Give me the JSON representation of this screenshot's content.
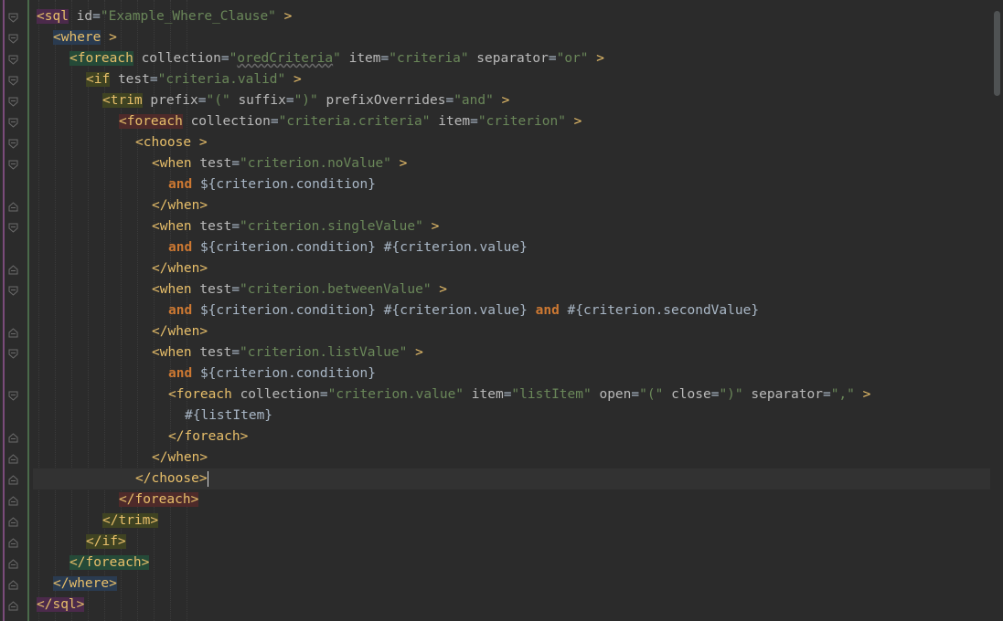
{
  "editor": {
    "lines": [
      {
        "fold": "open",
        "segments": [
          {
            "c": "tag",
            "t": "<sql",
            "h": "magenta"
          },
          {
            "c": "ws",
            "t": " "
          },
          {
            "c": "attr",
            "t": "id"
          },
          {
            "c": "text",
            "t": "="
          },
          {
            "c": "val",
            "t": "\"Example_Where_Clause\""
          },
          {
            "c": "ws",
            "t": " "
          },
          {
            "c": "tag",
            "t": ">"
          }
        ]
      },
      {
        "fold": "open",
        "segments": [
          {
            "c": "tag",
            "t": "<where",
            "h": "blue"
          },
          {
            "c": "ws",
            "t": " "
          },
          {
            "c": "tag",
            "t": ">"
          }
        ]
      },
      {
        "fold": "open",
        "segments": [
          {
            "c": "tag",
            "t": "<foreach",
            "h": "green"
          },
          {
            "c": "ws",
            "t": " "
          },
          {
            "c": "attr",
            "t": "collection"
          },
          {
            "c": "text",
            "t": "="
          },
          {
            "c": "val",
            "t": "\""
          },
          {
            "c": "val",
            "t": "oredCriteria",
            "sq": true
          },
          {
            "c": "val",
            "t": "\""
          },
          {
            "c": "ws",
            "t": " "
          },
          {
            "c": "attr",
            "t": "item"
          },
          {
            "c": "text",
            "t": "="
          },
          {
            "c": "val",
            "t": "\"criteria\""
          },
          {
            "c": "ws",
            "t": " "
          },
          {
            "c": "attr",
            "t": "separator"
          },
          {
            "c": "text",
            "t": "="
          },
          {
            "c": "val",
            "t": "\"or\""
          },
          {
            "c": "ws",
            "t": " "
          },
          {
            "c": "tag",
            "t": ">"
          }
        ]
      },
      {
        "fold": "open",
        "segments": [
          {
            "c": "tag",
            "t": "<if",
            "h": "olive"
          },
          {
            "c": "ws",
            "t": " "
          },
          {
            "c": "attr",
            "t": "test"
          },
          {
            "c": "text",
            "t": "="
          },
          {
            "c": "val",
            "t": "\"criteria.valid\""
          },
          {
            "c": "ws",
            "t": " "
          },
          {
            "c": "tag",
            "t": ">"
          }
        ]
      },
      {
        "fold": "open",
        "segments": [
          {
            "c": "tag",
            "t": "<trim",
            "h": "olive"
          },
          {
            "c": "ws",
            "t": " "
          },
          {
            "c": "attr",
            "t": "prefix"
          },
          {
            "c": "text",
            "t": "="
          },
          {
            "c": "val",
            "t": "\"(\""
          },
          {
            "c": "ws",
            "t": " "
          },
          {
            "c": "attr",
            "t": "suffix"
          },
          {
            "c": "text",
            "t": "="
          },
          {
            "c": "val",
            "t": "\")\""
          },
          {
            "c": "ws",
            "t": " "
          },
          {
            "c": "attr",
            "t": "prefixOverrides"
          },
          {
            "c": "text",
            "t": "="
          },
          {
            "c": "val",
            "t": "\"and\""
          },
          {
            "c": "ws",
            "t": " "
          },
          {
            "c": "tag",
            "t": ">"
          }
        ]
      },
      {
        "fold": "open",
        "segments": [
          {
            "c": "tag",
            "t": "<foreach",
            "h": "red"
          },
          {
            "c": "ws",
            "t": " "
          },
          {
            "c": "attr",
            "t": "collection"
          },
          {
            "c": "text",
            "t": "="
          },
          {
            "c": "val",
            "t": "\"criteria.criteria\""
          },
          {
            "c": "ws",
            "t": " "
          },
          {
            "c": "attr",
            "t": "item"
          },
          {
            "c": "text",
            "t": "="
          },
          {
            "c": "val",
            "t": "\"criterion\""
          },
          {
            "c": "ws",
            "t": " "
          },
          {
            "c": "tag",
            "t": ">"
          }
        ]
      },
      {
        "fold": "open",
        "segments": [
          {
            "c": "tag",
            "t": "<choose"
          },
          {
            "c": "ws",
            "t": " "
          },
          {
            "c": "tag",
            "t": ">"
          }
        ]
      },
      {
        "fold": "open",
        "segments": [
          {
            "c": "tag",
            "t": "<when"
          },
          {
            "c": "ws",
            "t": " "
          },
          {
            "c": "attr",
            "t": "test"
          },
          {
            "c": "text",
            "t": "="
          },
          {
            "c": "val",
            "t": "\"criterion.noValue\""
          },
          {
            "c": "ws",
            "t": " "
          },
          {
            "c": "tag",
            "t": ">"
          }
        ]
      },
      {
        "fold": "none",
        "segments": [
          {
            "c": "kw",
            "t": "and"
          },
          {
            "c": "ws",
            "t": " "
          },
          {
            "c": "text",
            "t": "${criterion.condition}"
          }
        ]
      },
      {
        "fold": "close",
        "segments": [
          {
            "c": "tag",
            "t": "</when>"
          }
        ]
      },
      {
        "fold": "open",
        "segments": [
          {
            "c": "tag",
            "t": "<when"
          },
          {
            "c": "ws",
            "t": " "
          },
          {
            "c": "attr",
            "t": "test"
          },
          {
            "c": "text",
            "t": "="
          },
          {
            "c": "val",
            "t": "\"criterion.singleValue\""
          },
          {
            "c": "ws",
            "t": " "
          },
          {
            "c": "tag",
            "t": ">"
          }
        ]
      },
      {
        "fold": "none",
        "segments": [
          {
            "c": "kw",
            "t": "and"
          },
          {
            "c": "ws",
            "t": " "
          },
          {
            "c": "text",
            "t": "${criterion.condition}"
          },
          {
            "c": "ws",
            "t": " "
          },
          {
            "c": "text",
            "t": "#{criterion.value}"
          }
        ]
      },
      {
        "fold": "close",
        "segments": [
          {
            "c": "tag",
            "t": "</when>"
          }
        ]
      },
      {
        "fold": "open",
        "segments": [
          {
            "c": "tag",
            "t": "<when"
          },
          {
            "c": "ws",
            "t": " "
          },
          {
            "c": "attr",
            "t": "test"
          },
          {
            "c": "text",
            "t": "="
          },
          {
            "c": "val",
            "t": "\"criterion.betweenValue\""
          },
          {
            "c": "ws",
            "t": " "
          },
          {
            "c": "tag",
            "t": ">"
          }
        ]
      },
      {
        "fold": "none",
        "segments": [
          {
            "c": "kw",
            "t": "and"
          },
          {
            "c": "ws",
            "t": " "
          },
          {
            "c": "text",
            "t": "${criterion.condition}"
          },
          {
            "c": "ws",
            "t": " "
          },
          {
            "c": "text",
            "t": "#{criterion.value}"
          },
          {
            "c": "ws",
            "t": " "
          },
          {
            "c": "kw",
            "t": "and"
          },
          {
            "c": "ws",
            "t": " "
          },
          {
            "c": "text",
            "t": "#{criterion.secondValue}"
          }
        ]
      },
      {
        "fold": "close",
        "segments": [
          {
            "c": "tag",
            "t": "</when>"
          }
        ]
      },
      {
        "fold": "open",
        "segments": [
          {
            "c": "tag",
            "t": "<when"
          },
          {
            "c": "ws",
            "t": " "
          },
          {
            "c": "attr",
            "t": "test"
          },
          {
            "c": "text",
            "t": "="
          },
          {
            "c": "val",
            "t": "\"criterion.listValue\""
          },
          {
            "c": "ws",
            "t": " "
          },
          {
            "c": "tag",
            "t": ">"
          }
        ]
      },
      {
        "fold": "none",
        "segments": [
          {
            "c": "kw",
            "t": "and"
          },
          {
            "c": "ws",
            "t": " "
          },
          {
            "c": "text",
            "t": "${criterion.condition}"
          }
        ]
      },
      {
        "fold": "open",
        "segments": [
          {
            "c": "tag",
            "t": "<foreach"
          },
          {
            "c": "ws",
            "t": " "
          },
          {
            "c": "attr",
            "t": "collection"
          },
          {
            "c": "text",
            "t": "="
          },
          {
            "c": "val",
            "t": "\"criterion.value\""
          },
          {
            "c": "ws",
            "t": " "
          },
          {
            "c": "attr",
            "t": "item"
          },
          {
            "c": "text",
            "t": "="
          },
          {
            "c": "val",
            "t": "\"listItem\""
          },
          {
            "c": "ws",
            "t": " "
          },
          {
            "c": "attr",
            "t": "open"
          },
          {
            "c": "text",
            "t": "="
          },
          {
            "c": "val",
            "t": "\"(\""
          },
          {
            "c": "ws",
            "t": " "
          },
          {
            "c": "attr",
            "t": "close"
          },
          {
            "c": "text",
            "t": "="
          },
          {
            "c": "val",
            "t": "\")\""
          },
          {
            "c": "ws",
            "t": " "
          },
          {
            "c": "attr",
            "t": "separator"
          },
          {
            "c": "text",
            "t": "="
          },
          {
            "c": "val",
            "t": "\",\""
          },
          {
            "c": "ws",
            "t": " "
          },
          {
            "c": "tag",
            "t": ">"
          }
        ]
      },
      {
        "fold": "none",
        "segments": [
          {
            "c": "text",
            "t": "#{listItem}"
          }
        ]
      },
      {
        "fold": "close",
        "segments": [
          {
            "c": "tag",
            "t": "</foreach>"
          }
        ]
      },
      {
        "fold": "close",
        "segments": [
          {
            "c": "tag",
            "t": "</when>"
          }
        ]
      },
      {
        "fold": "close",
        "current": true,
        "segments": [
          {
            "c": "tag",
            "t": "</choose>"
          }
        ]
      },
      {
        "fold": "close",
        "segments": [
          {
            "c": "tag",
            "t": "</foreach>",
            "h": "red"
          }
        ]
      },
      {
        "fold": "close",
        "segments": [
          {
            "c": "tag",
            "t": "</trim>",
            "h": "olive"
          }
        ]
      },
      {
        "fold": "close",
        "segments": [
          {
            "c": "tag",
            "t": "</if>",
            "h": "olive"
          }
        ]
      },
      {
        "fold": "close",
        "segments": [
          {
            "c": "tag",
            "t": "</foreach>",
            "h": "green"
          }
        ]
      },
      {
        "fold": "close",
        "segments": [
          {
            "c": "tag",
            "t": "</where>",
            "h": "blue"
          }
        ]
      },
      {
        "fold": "close",
        "segments": [
          {
            "c": "tag",
            "t": "</sql>",
            "h": "magenta"
          }
        ]
      }
    ],
    "colors": {
      "background": "#2b2b2b",
      "tag": "#e8bf6a",
      "attribute": "#bababa",
      "string": "#6a8759",
      "keyword": "#cc7832",
      "text": "#a9b7c6"
    }
  }
}
